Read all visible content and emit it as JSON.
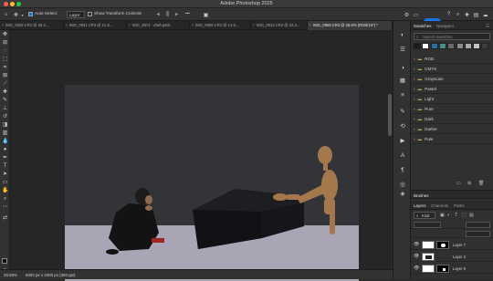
{
  "app": {
    "title": "Adobe Photoshop 2025"
  },
  "options_bar": {
    "auto_select_label": "Auto-Select:",
    "auto_select_value": "Layer",
    "show_transform_label": "Show Transform Controls",
    "three_dot": "•••",
    "share_label": "Share"
  },
  "tabs": [
    {
      "label": "IMG_0926.CR3 @ 28.2...",
      "active": false
    },
    {
      "label": "IMG_0931.CR3 @ 21.8...",
      "active": false
    },
    {
      "label": "IMG_9874 - draft.psdc",
      "active": false
    },
    {
      "label": "IMG_0906.CR3 @ 13.6...",
      "active": false
    },
    {
      "label": "IMG_0912.CR3 @ 33.3...",
      "active": false
    },
    {
      "label": "IMG_0959.CR3 @ 28.6% (RGB/16*) *",
      "active": true
    }
  ],
  "swatches_panel": {
    "tabs": [
      "Swatches",
      "Navigator"
    ],
    "search_placeholder": "Search Swatches",
    "colors": [
      "#1a1a1a",
      "#ffffff",
      "#2b6fa1",
      "#4a8c8c",
      "#6a6a6a",
      "#8c8c8c",
      "#a8a8a8",
      "#c4c4c4",
      "#3d3d3d"
    ],
    "folders": [
      "RGB",
      "CMYK",
      "Grayscale",
      "Pastel",
      "Light",
      "Pure",
      "Dark",
      "Darker",
      "Pale"
    ]
  },
  "layers_panel": {
    "header_tab": "Brushes",
    "tabs": [
      "Layers",
      "Channels",
      "Paths"
    ],
    "kind_label": "Kind",
    "layers": [
      {
        "name": "Layer 7"
      },
      {
        "name": "Layer 3"
      },
      {
        "name": "Layer 9"
      }
    ]
  },
  "status_bar": {
    "zoom": "28.59%",
    "info": "6000 px x 4000 px (300 ppi)"
  }
}
